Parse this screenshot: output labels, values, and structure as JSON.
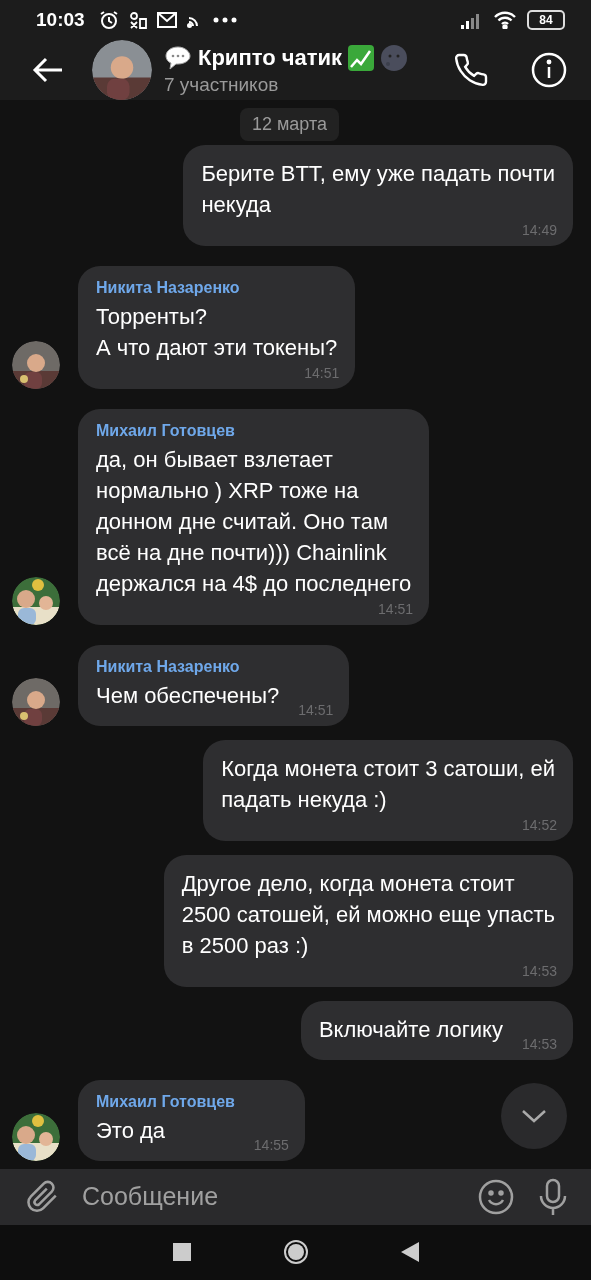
{
  "status_bar": {
    "time": "10:03",
    "battery": "84"
  },
  "header": {
    "title": "Крипто чатик",
    "subtitle": "7 участников"
  },
  "date_chip": "12 марта",
  "messages": [
    {
      "kind": "outgoing",
      "text": "Берите BTT, ему уже падать почти\nнекуда",
      "time": "14:49"
    },
    {
      "kind": "incoming",
      "sender": "Никита Назаренко",
      "text": "Торренты?\nА что дают эти токены?",
      "time": "14:51"
    },
    {
      "kind": "incoming",
      "sender": "Михаил Готовцев",
      "text": "да, он бывает взлетает\nнормально ) XRP тоже на\nдонном дне считай. Оно там\nвсё на дне почти))) Chainlink\nдержался на 4$ до последнего",
      "time": "14:51"
    },
    {
      "kind": "incoming",
      "sender": "Никита Назаренко",
      "text": "Чем обеспечены?",
      "time": "14:51"
    },
    {
      "kind": "outgoing",
      "text": "Когда монета стоит 3 сатоши, ей\nпадать некуда :)",
      "time": "14:52"
    },
    {
      "kind": "outgoing",
      "text": "Другое дело, когда монета стоит\n2500 сатошей, ей можно еще упасть\nв 2500 раз :)",
      "time": "14:53"
    },
    {
      "kind": "outgoing",
      "text": "Включайте логику",
      "time": "14:53"
    },
    {
      "kind": "incoming",
      "sender": "Михаил Готовцев",
      "text": "Это да",
      "time": "14:55"
    }
  ],
  "composer": {
    "placeholder": "Сообщение"
  }
}
